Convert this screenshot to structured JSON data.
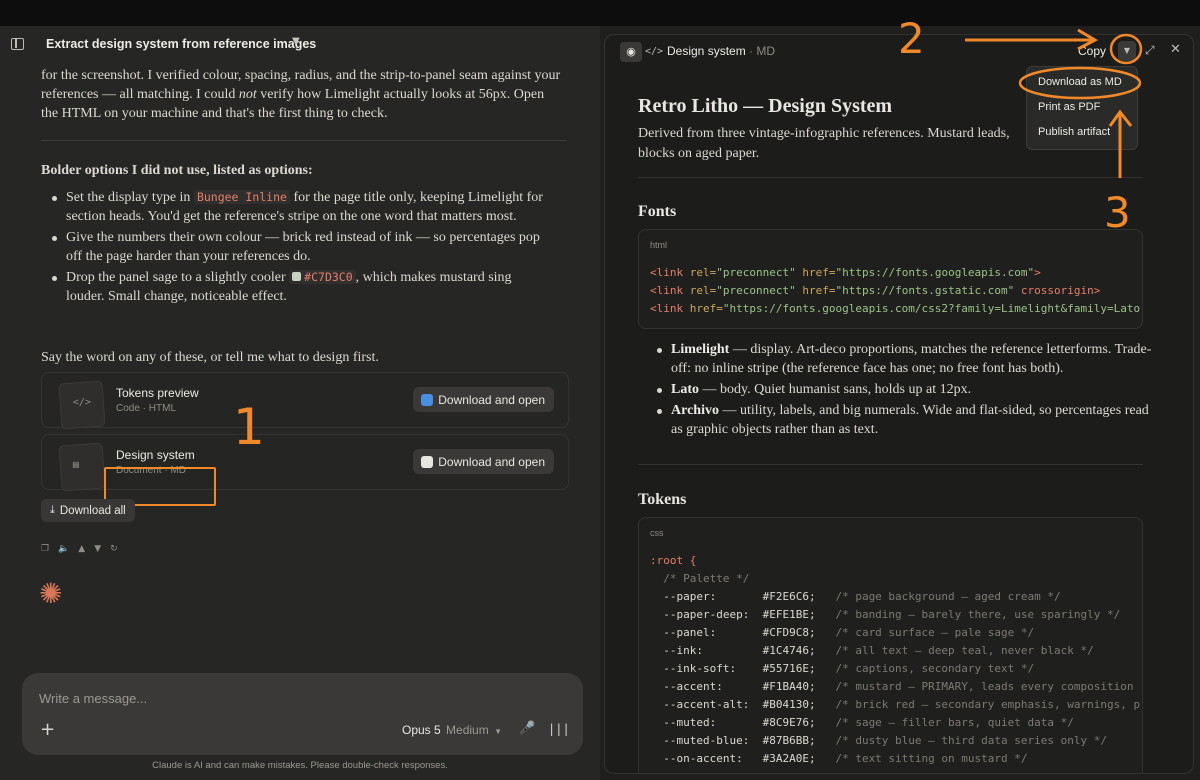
{
  "left": {
    "title": "Extract design system from reference images",
    "para1_a": "for the screenshot. I verified colour, spacing, radius, and the strip-to-panel seam against your references — all matching. I could ",
    "para1_em": "not",
    "para1_b": " verify how Limelight actually looks at 56px. Open the HTML on your machine and that's the first thing to check.",
    "heading": "Bolder options I did not use, listed as options:",
    "b1_a": "Set the display type in ",
    "b1_code": "Bungee Inline",
    "b1_b": " for the page title only, keeping Limelight for section heads. You'd get the reference's stripe on the one word that matters most.",
    "b2": "Give the numbers their own colour — brick red instead of ink — so percentages pop off the page harder than your references do.",
    "b3_a": "Drop the panel sage to a slightly cooler ",
    "b3_code": "#C7D3C0",
    "b3_b": ", which makes mustard sing louder. Small change, noticeable effect.",
    "para3": "Say the word on any of these, or tell me what to design first.",
    "cards": [
      {
        "title": "Tokens preview",
        "sub": "Code · HTML",
        "button": "Download and open",
        "icon": "code-icon"
      },
      {
        "title": "Design system",
        "sub": "Document · MD",
        "button": "Download and open",
        "icon": "document-icon"
      }
    ],
    "download_all": "Download all",
    "composer": {
      "placeholder": "Write a message...",
      "model": "Opus 5",
      "effort": "Medium"
    },
    "disclaimer": "Claude is AI and can make mistakes. Please double-check responses."
  },
  "right": {
    "doc_title": "Design system",
    "doc_type": "· MD",
    "copy": "Copy",
    "menu": [
      "Download as MD",
      "Print as PDF",
      "Publish artifact"
    ],
    "h1": "Retro Litho — Design System",
    "sub": "Derived from three vintage-infographic references. Mustard leads, blocks on aged paper.",
    "fonts_h": "Fonts",
    "fonts_lang": "html",
    "fonts_code": [
      [
        "<link ",
        "rel=",
        "\"preconnect\"",
        " href=",
        "\"https://fonts.googleapis.com\"",
        ">"
      ],
      [
        "<link ",
        "rel=",
        "\"preconnect\"",
        " href=",
        "\"https://fonts.gstatic.com\"",
        " crossorigin>"
      ],
      [
        "<link ",
        "href=",
        "\"https://fonts.googleapis.com/css2?family=Limelight&family=Lato",
        "",
        "",
        ""
      ]
    ],
    "font_list": [
      {
        "name": "Limelight",
        "desc": " — display. Art-deco proportions, matches the reference letterforms. Trade-off: no inline stripe (the reference face has one; no free font has both)."
      },
      {
        "name": "Lato",
        "desc": " — body. Quiet humanist sans, holds up at 12px."
      },
      {
        "name": "Archivo",
        "desc": " — utility, labels, and big numerals. Wide and flat-sided, so percentages read as graphic objects rather than as text."
      }
    ],
    "tokens_h": "Tokens",
    "tokens_lang": "css",
    "tokens_root": ":root {",
    "tokens_palette": "  /* Palette */",
    "tokens": [
      {
        "name": "  --paper:",
        "value": "#F2E6C6;",
        "comment": "/* page background — aged cream */"
      },
      {
        "name": "  --paper-deep:",
        "value": "#EFE1BE;",
        "comment": "/* banding — barely there, use sparingly */"
      },
      {
        "name": "  --panel:",
        "value": "#CFD9C8;",
        "comment": "/* card surface — pale sage */"
      },
      {
        "name": "  --ink:",
        "value": "#1C4746;",
        "comment": "/* all text — deep teal, never black */"
      },
      {
        "name": "  --ink-soft:",
        "value": "#55716E;",
        "comment": "/* captions, secondary text */"
      },
      {
        "name": "  --accent:",
        "value": "#F1BA40;",
        "comment": "/* mustard — PRIMARY, leads every composition"
      },
      {
        "name": "  --accent-alt:",
        "value": "#B04130;",
        "comment": "/* brick red — secondary emphasis, warnings, p"
      },
      {
        "name": "  --muted:",
        "value": "#8C9E76;",
        "comment": "/* sage — filler bars, quiet data */"
      },
      {
        "name": "  --muted-blue:",
        "value": "#87B6BB;",
        "comment": "/* dusty blue — third data series only */"
      },
      {
        "name": "  --on-accent:",
        "value": "#3A2A0E;",
        "comment": "/* text sitting on mustard */"
      }
    ]
  },
  "annotations": {
    "n1": "1",
    "n2": "2",
    "n3": "3"
  },
  "colors": {
    "accent": "#d97757",
    "annotation": "#f0892a",
    "panel_swatch": "#C7D3C0"
  }
}
